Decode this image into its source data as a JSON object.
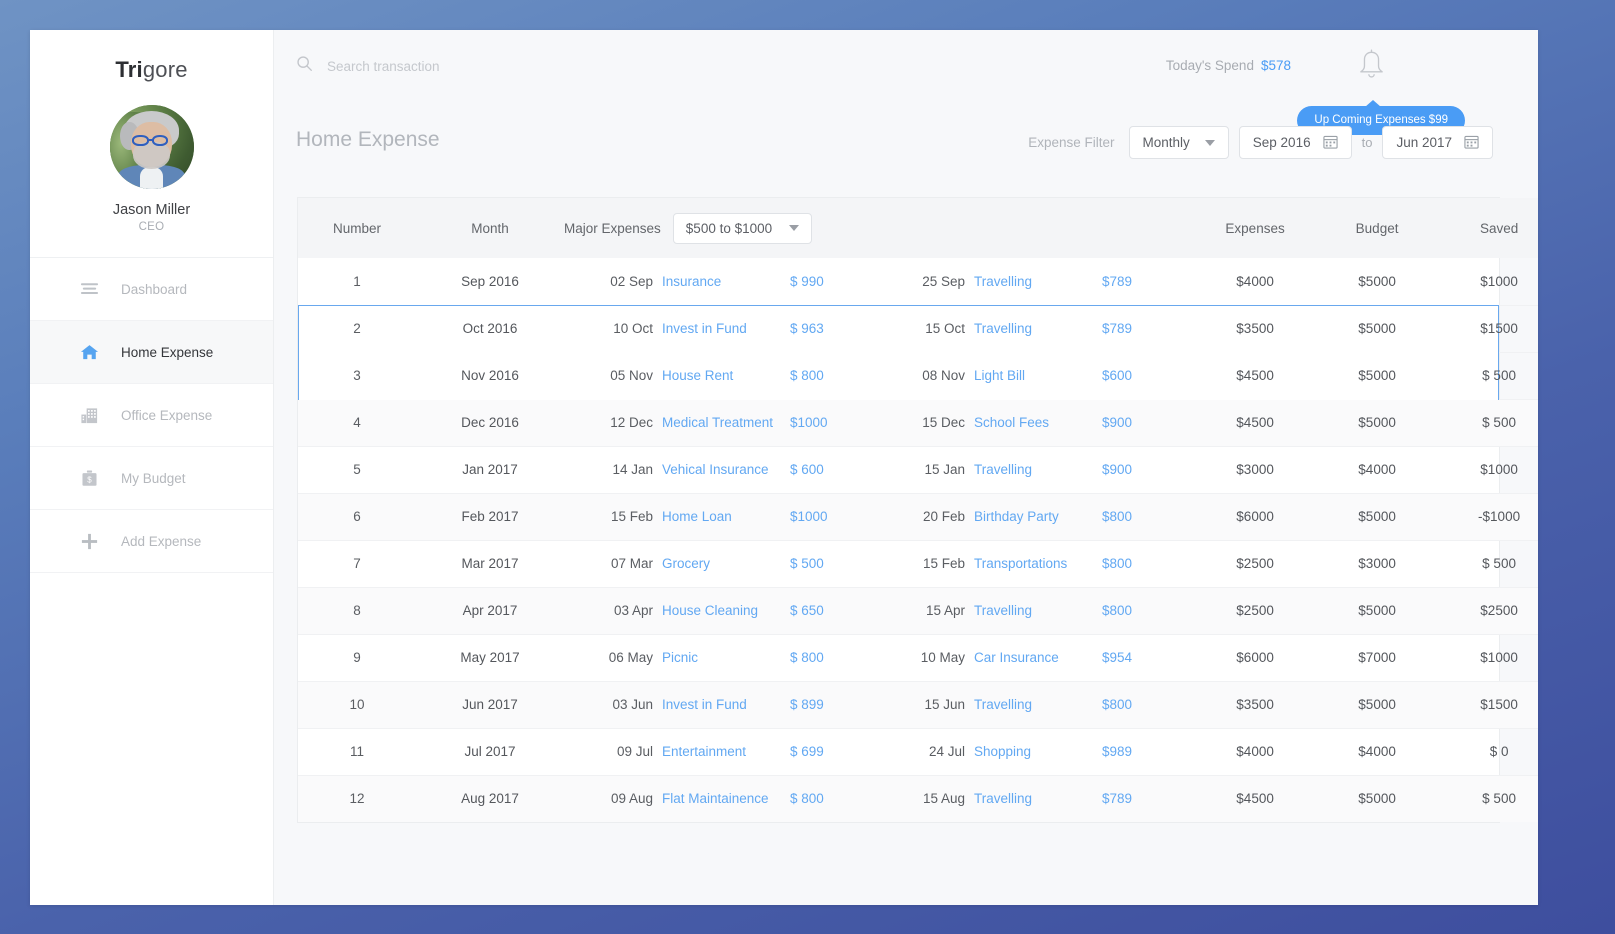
{
  "brand": {
    "part1": "Tri",
    "part2": "gore"
  },
  "profile": {
    "name": "Jason Miller",
    "role": "CEO"
  },
  "sidebar": {
    "items": [
      {
        "label": "Dashboard",
        "icon": "list-icon",
        "active": false
      },
      {
        "label": "Home Expense",
        "icon": "home-icon",
        "active": true
      },
      {
        "label": "Office Expense",
        "icon": "building-icon",
        "active": false
      },
      {
        "label": "My Budget",
        "icon": "briefcase-dollar-icon",
        "active": false
      },
      {
        "label": "Add Expense",
        "icon": "plus-icon",
        "active": false
      }
    ]
  },
  "topbar": {
    "search_placeholder": "Search transaction",
    "search_value": "",
    "spend_label": "Today's Spend",
    "spend_amount": "$578",
    "tooltip": "Up Coming Expenses $99"
  },
  "page": {
    "title": "Home Expense"
  },
  "filters": {
    "label": "Expense Filter",
    "period": "Monthly",
    "from": "Sep 2016",
    "to_label": "to",
    "to": "Jun 2017"
  },
  "table": {
    "headers": {
      "number": "Number",
      "month": "Month",
      "major_expenses": "Major Expenses",
      "range_filter": "$500 to $1000",
      "expenses": "Expenses",
      "budget": "Budget",
      "saved": "Saved"
    },
    "selected_rows": [
      2,
      3
    ],
    "rows": [
      {
        "number": "1",
        "month": "Sep 2016",
        "d1": "02 Sep",
        "c1": "Insurance",
        "a1": "$ 990",
        "d2": "25 Sep",
        "c2": "Travelling",
        "a2": "$789",
        "expenses": "$4000",
        "budget": "$5000",
        "saved": "$1000"
      },
      {
        "number": "2",
        "month": "Oct 2016",
        "d1": "10 Oct",
        "c1": "Invest in Fund",
        "a1": "$ 963",
        "d2": "15 Oct",
        "c2": "Travelling",
        "a2": "$789",
        "expenses": "$3500",
        "budget": "$5000",
        "saved": "$1500"
      },
      {
        "number": "3",
        "month": "Nov 2016",
        "d1": "05 Nov",
        "c1": "House Rent",
        "a1": "$ 800",
        "d2": "08 Nov",
        "c2": "Light Bill",
        "a2": "$600",
        "expenses": "$4500",
        "budget": "$5000",
        "saved": "$  500"
      },
      {
        "number": "4",
        "month": "Dec 2016",
        "d1": "12 Dec",
        "c1": "Medical Treatment",
        "a1": "$1000",
        "d2": "15 Dec",
        "c2": "School Fees",
        "a2": "$900",
        "expenses": "$4500",
        "budget": "$5000",
        "saved": "$  500"
      },
      {
        "number": "5",
        "month": "Jan 2017",
        "d1": "14 Jan",
        "c1": "Vehical Insurance",
        "a1": "$ 600",
        "d2": "15 Jan",
        "c2": "Travelling",
        "a2": "$900",
        "expenses": "$3000",
        "budget": "$4000",
        "saved": "$1000"
      },
      {
        "number": "6",
        "month": "Feb 2017",
        "d1": "15 Feb",
        "c1": "Home Loan",
        "a1": "$1000",
        "d2": "20 Feb",
        "c2": "Birthday Party",
        "a2": "$800",
        "expenses": "$6000",
        "budget": "$5000",
        "saved": "-$1000"
      },
      {
        "number": "7",
        "month": "Mar 2017",
        "d1": "07 Mar",
        "c1": "Grocery",
        "a1": "$ 500",
        "d2": "15 Feb",
        "c2": "Transportations",
        "a2": "$800",
        "expenses": "$2500",
        "budget": "$3000",
        "saved": "$  500"
      },
      {
        "number": "8",
        "month": "Apr 2017",
        "d1": "03 Apr",
        "c1": "House Cleaning",
        "a1": "$ 650",
        "d2": "15 Apr",
        "c2": "Travelling",
        "a2": "$800",
        "expenses": "$2500",
        "budget": "$5000",
        "saved": "$2500"
      },
      {
        "number": "9",
        "month": "May 2017",
        "d1": "06 May",
        "c1": "Picnic",
        "a1": "$ 800",
        "d2": "10 May",
        "c2": "Car Insurance",
        "a2": "$954",
        "expenses": "$6000",
        "budget": "$7000",
        "saved": "$1000"
      },
      {
        "number": "10",
        "month": "Jun 2017",
        "d1": "03 Jun",
        "c1": "Invest in Fund",
        "a1": "$ 899",
        "d2": "15 Jun",
        "c2": "Travelling",
        "a2": "$800",
        "expenses": "$3500",
        "budget": "$5000",
        "saved": "$1500"
      },
      {
        "number": "11",
        "month": "Jul  2017",
        "d1": "09 Jul",
        "c1": "Entertainment",
        "a1": "$ 699",
        "d2": "24 Jul",
        "c2": "Shopping",
        "a2": "$989",
        "expenses": "$4000",
        "budget": "$4000",
        "saved": "$  0"
      },
      {
        "number": "12",
        "month": "Aug 2017",
        "d1": "09 Aug",
        "c1": "Flat Maintainence",
        "a1": "$ 800",
        "d2": "15 Aug",
        "c2": "Travelling",
        "a2": "$789",
        "expenses": "$4500",
        "budget": "$5000",
        "saved": "$  500"
      }
    ]
  },
  "colors": {
    "accent": "#4a9cf5",
    "link": "#62a8f2",
    "selection_border": "#69a8ee",
    "page_bg_top": "#6f93c4",
    "page_bg_bottom": "#3e4e9e"
  }
}
